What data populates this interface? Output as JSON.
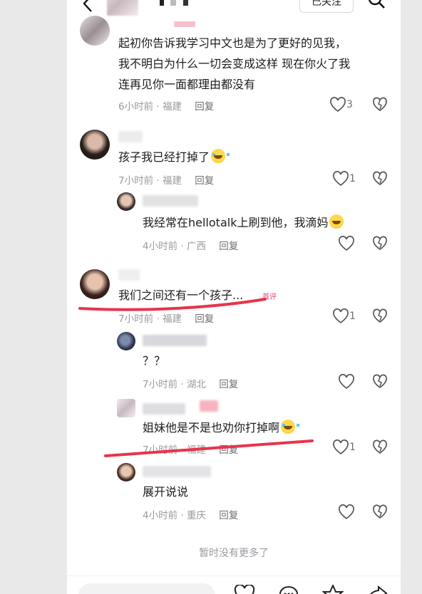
{
  "header": {
    "follow_label": "已关注",
    "icons": [
      "back-icon",
      "search-icon"
    ]
  },
  "comments": [
    {
      "text_lines": [
        "起初你告诉我学习中文也是为了更好的见我，",
        "我不明白为什么一切会变成这样 现在你火了我",
        "连再见你一面都理由都没有"
      ],
      "time": "6小时前",
      "location": "福建",
      "reply_label": "回复",
      "likes": "3"
    },
    {
      "text": "孩子我已经打掉了",
      "emoji": "crying-face",
      "time": "7小时前",
      "location": "福建",
      "reply_label": "回复",
      "likes": "1"
    },
    {
      "text": "我经常在hellotalk上刷到他，我滴妈",
      "emoji": "shocked-face",
      "time": "4小时前",
      "location": "广西",
      "reply_label": "回复",
      "likes": ""
    },
    {
      "text": "我们之间还有一个孩子...",
      "badge": "首评",
      "time": "7小时前",
      "location": "福建",
      "reply_label": "回复",
      "likes": "1"
    },
    {
      "text": "？？",
      "time": "7小时前",
      "location": "湖北",
      "reply_label": "回复",
      "likes": ""
    },
    {
      "text": "姐妹他是不是也劝你打掉啊",
      "emoji": "crying-face",
      "time": "7小时前",
      "location": "福建",
      "reply_label": "回复",
      "likes": "1"
    },
    {
      "text": "展开说说",
      "time": "4小时前",
      "location": "重庆",
      "reply_label": "回复",
      "likes": ""
    }
  ],
  "footer": {
    "no_more": "暂时没有更多了"
  },
  "bottom_bar": {
    "icons": [
      "heart-icon",
      "chat-icon",
      "star-icon",
      "share-icon"
    ]
  },
  "colors": {
    "annotation_red": "#e8344b",
    "meta_gray": "#9a9aa0",
    "badge_pink": "#e8466e"
  }
}
